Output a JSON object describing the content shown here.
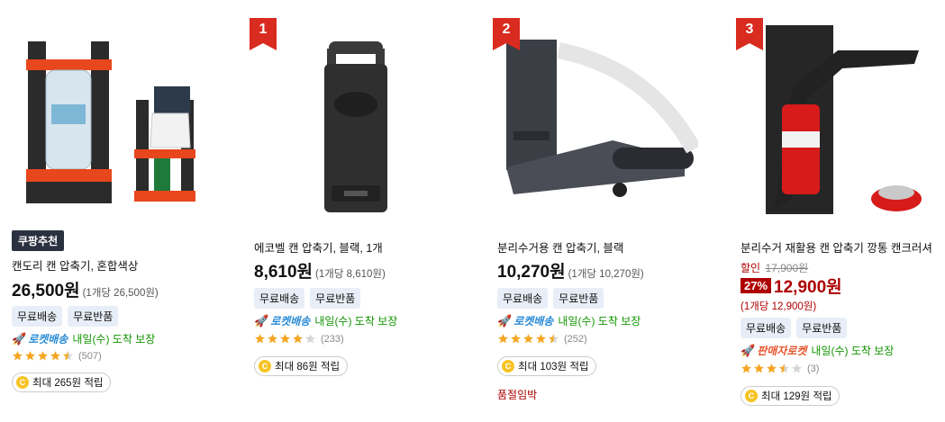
{
  "products": [
    {
      "rank": "",
      "recommend_badge": "쿠팡추천",
      "title": "캔도리 캔 압축기, 혼합색상",
      "price": "26,500원",
      "unit_price": "(1개당 26,500원)",
      "tags": [
        "무료배송",
        "무료반품"
      ],
      "shipping_name": "로켓배송",
      "shipping_text": "내일(수) 도착 보장",
      "rating": 4.5,
      "review_count": "(507)",
      "reward": "최대 265원 적립"
    },
    {
      "rank": "1",
      "title": "에코벨 캔 압축기, 블랙, 1개",
      "price": "8,610원",
      "unit_price": "(1개당 8,610원)",
      "tags": [
        "무료배송",
        "무료반품"
      ],
      "shipping_name": "로켓배송",
      "shipping_text": "내일(수) 도착 보장",
      "rating": 4.0,
      "review_count": "(233)",
      "reward": "최대 86원 적립"
    },
    {
      "rank": "2",
      "title": "분리수거용 캔 압축기, 블랙",
      "price": "10,270원",
      "unit_price": "(1개당 10,270원)",
      "tags": [
        "무료배송",
        "무료반품"
      ],
      "shipping_name": "로켓배송",
      "shipping_text": "내일(수) 도착 보장",
      "rating": 4.5,
      "review_count": "(252)",
      "reward": "최대 103원 적립",
      "status": "품절임박"
    },
    {
      "rank": "3",
      "title": "분리수거 재활용 캔 압축기 깡통 캔크러셔",
      "discount_label": "할인",
      "original_price": "17,900원",
      "discount_percent": "27%",
      "price": "12,900원",
      "unit_price": "(1개당 12,900원)",
      "tags": [
        "무료배송",
        "무료반품"
      ],
      "shipping_name": "판매자로켓",
      "shipping_text": "내일(수) 도착 보장",
      "rating": 3.5,
      "review_count": "(3)",
      "reward": "최대 129원 적립"
    }
  ],
  "colors": {
    "rank_badge": "#d92b1f",
    "price_red": "#ae0000",
    "rocket_blue": "#2a8bd6",
    "delivery_green": "#119500",
    "star": "#f5a623",
    "tag_bg": "#e8eef7"
  },
  "icons": {
    "rank": "ribbon-flag-icon",
    "shipping": "rocket-icon",
    "star": "star-icon",
    "reward": "coin-icon"
  }
}
